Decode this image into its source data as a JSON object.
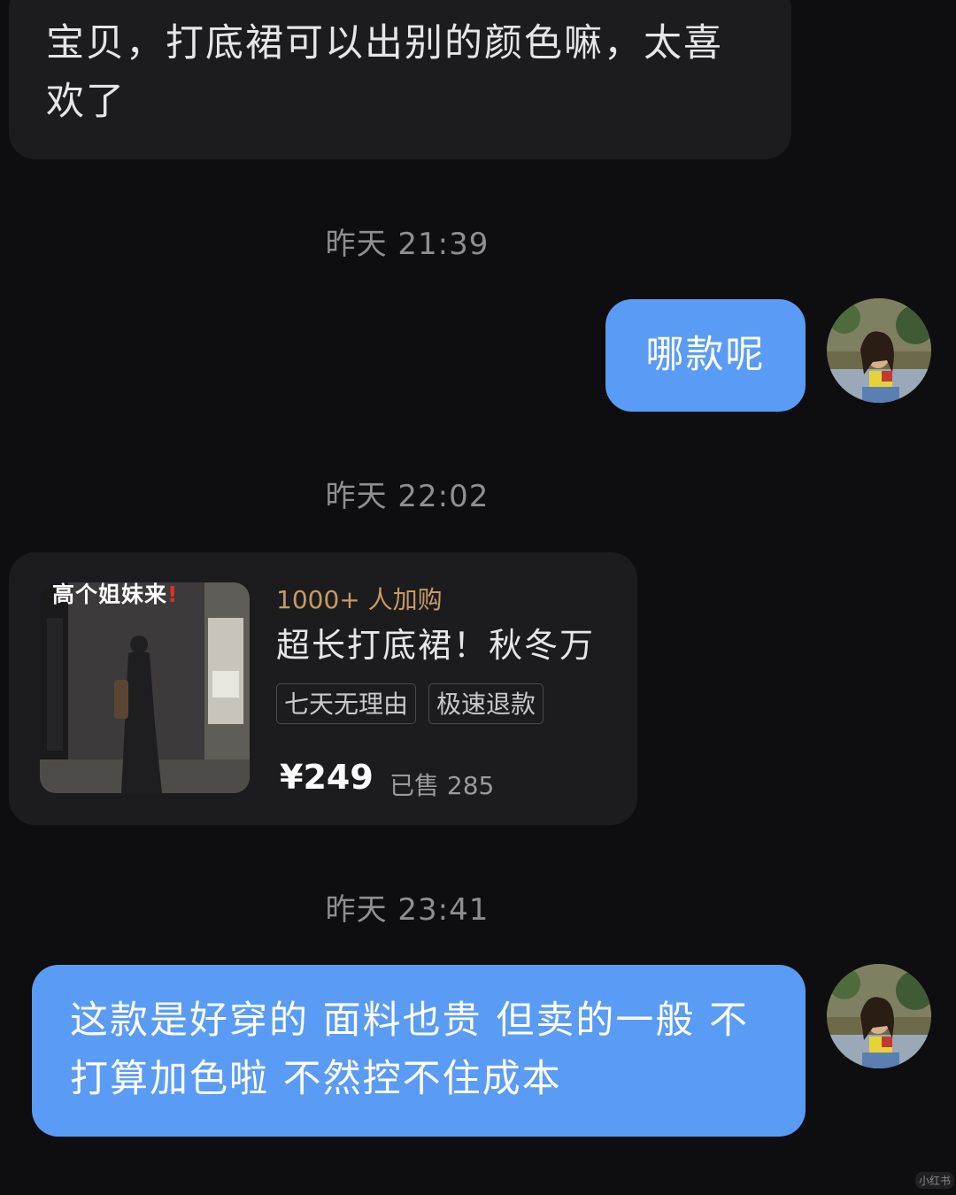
{
  "messages": {
    "first_received": "宝贝，打底裙可以出别的颜色嘛，太喜欢了",
    "time_1": "昨天 21:39",
    "sent_1": "哪款呢",
    "time_2": "昨天 22:02",
    "time_3": "昨天 23:41",
    "sent_2": "这款是好穿的 面料也贵 但卖的一般 不打算加色啦 不然控不住成本"
  },
  "product_card": {
    "image_caption": "高个姐妹来",
    "buyers": "1000+ 人加购",
    "title": "超长打底裙！秋冬万",
    "tags": [
      "七天无理由",
      "极速退款"
    ],
    "price": "¥249",
    "sold": "已售 285"
  },
  "watermark": "小红书",
  "colors": {
    "background": "#0e0e10",
    "received_bubble": "#1c1c1f",
    "sent_bubble": "#5a9cf5",
    "buyers_text": "#c79a64"
  },
  "icons": {
    "avatar": "user-avatar",
    "caption_mark": "red-exclamation-icon"
  }
}
